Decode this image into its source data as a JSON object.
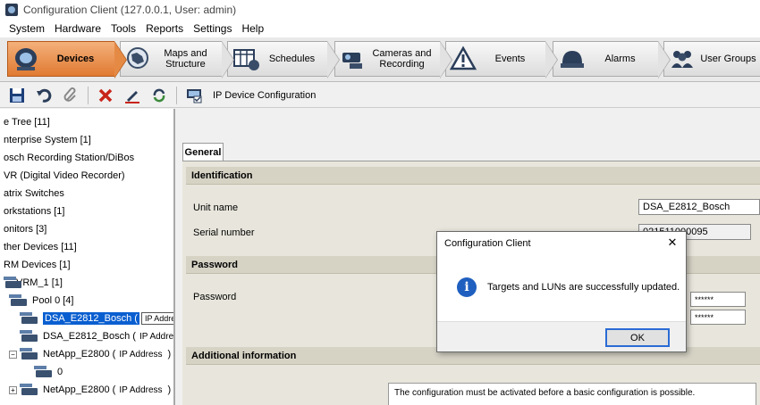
{
  "window": {
    "title": "Configuration Client (127.0.0.1, User: admin)"
  },
  "menu": [
    "System",
    "Hardware",
    "Tools",
    "Reports",
    "Settings",
    "Help"
  ],
  "tabs": [
    {
      "label": "Devices",
      "icon": "devices-icon",
      "active": true
    },
    {
      "label": "Maps and Structure",
      "icon": "maps-icon",
      "active": false
    },
    {
      "label": "Schedules",
      "icon": "schedules-icon",
      "active": false
    },
    {
      "label": "Cameras and Recording",
      "icon": "cameras-icon",
      "active": false
    },
    {
      "label": "Events",
      "icon": "events-icon",
      "active": false
    },
    {
      "label": "Alarms",
      "icon": "alarms-icon",
      "active": false
    },
    {
      "label": "User Groups",
      "icon": "user-groups-icon",
      "active": false
    }
  ],
  "toolbar": {
    "icons": [
      "save-icon",
      "undo-icon",
      "attach-icon",
      "delete-icon",
      "edit-icon",
      "refresh-icon",
      "ip-config-icon"
    ],
    "ip_config_label": "IP Device Configuration"
  },
  "tree": {
    "items": [
      {
        "label": "e Tree [11]"
      },
      {
        "label": "nterprise System [1]"
      },
      {
        "label": "osch Recording Station/DiBos"
      },
      {
        "label": "VR (Digital Video Recorder)"
      },
      {
        "label": "atrix Switches"
      },
      {
        "label": "orkstations [1]"
      },
      {
        "label": "onitors [3]"
      },
      {
        "label": "ther Devices [11]"
      },
      {
        "label": "RM Devices [1]"
      },
      {
        "label": "VRM_1 [1]"
      },
      {
        "label": "Pool 0 [4]"
      },
      {
        "label": "DSA_E2812_Bosch (",
        "ip": "IP Address"
      },
      {
        "label": "DSA_E2812_Bosch (",
        "ip": "IP Address"
      },
      {
        "label": "NetApp_E2800 (",
        "ip": "IP Address",
        "suffix": ") [1"
      },
      {
        "label": "0"
      },
      {
        "label": "NetApp_E2800 (",
        "ip": "IP Address",
        "suffix": ") [1"
      }
    ]
  },
  "panel": {
    "tab": "General",
    "identification": {
      "header": "Identification",
      "unit_name_label": "Unit name",
      "unit_name_value": "DSA_E2812_Bosch",
      "serial_label": "Serial number",
      "serial_value": "021511000095"
    },
    "password": {
      "header": "Password",
      "password_label": "Password",
      "masked_1": "******",
      "masked_2": "******"
    },
    "additional": {
      "header": "Additional information",
      "message": "The configuration must be activated before a basic configuration is possible."
    }
  },
  "dialog": {
    "title": "Configuration Client",
    "message": "Targets and LUNs are successfully updated.",
    "ok": "OK",
    "close": "✕",
    "info_glyph": "i"
  }
}
